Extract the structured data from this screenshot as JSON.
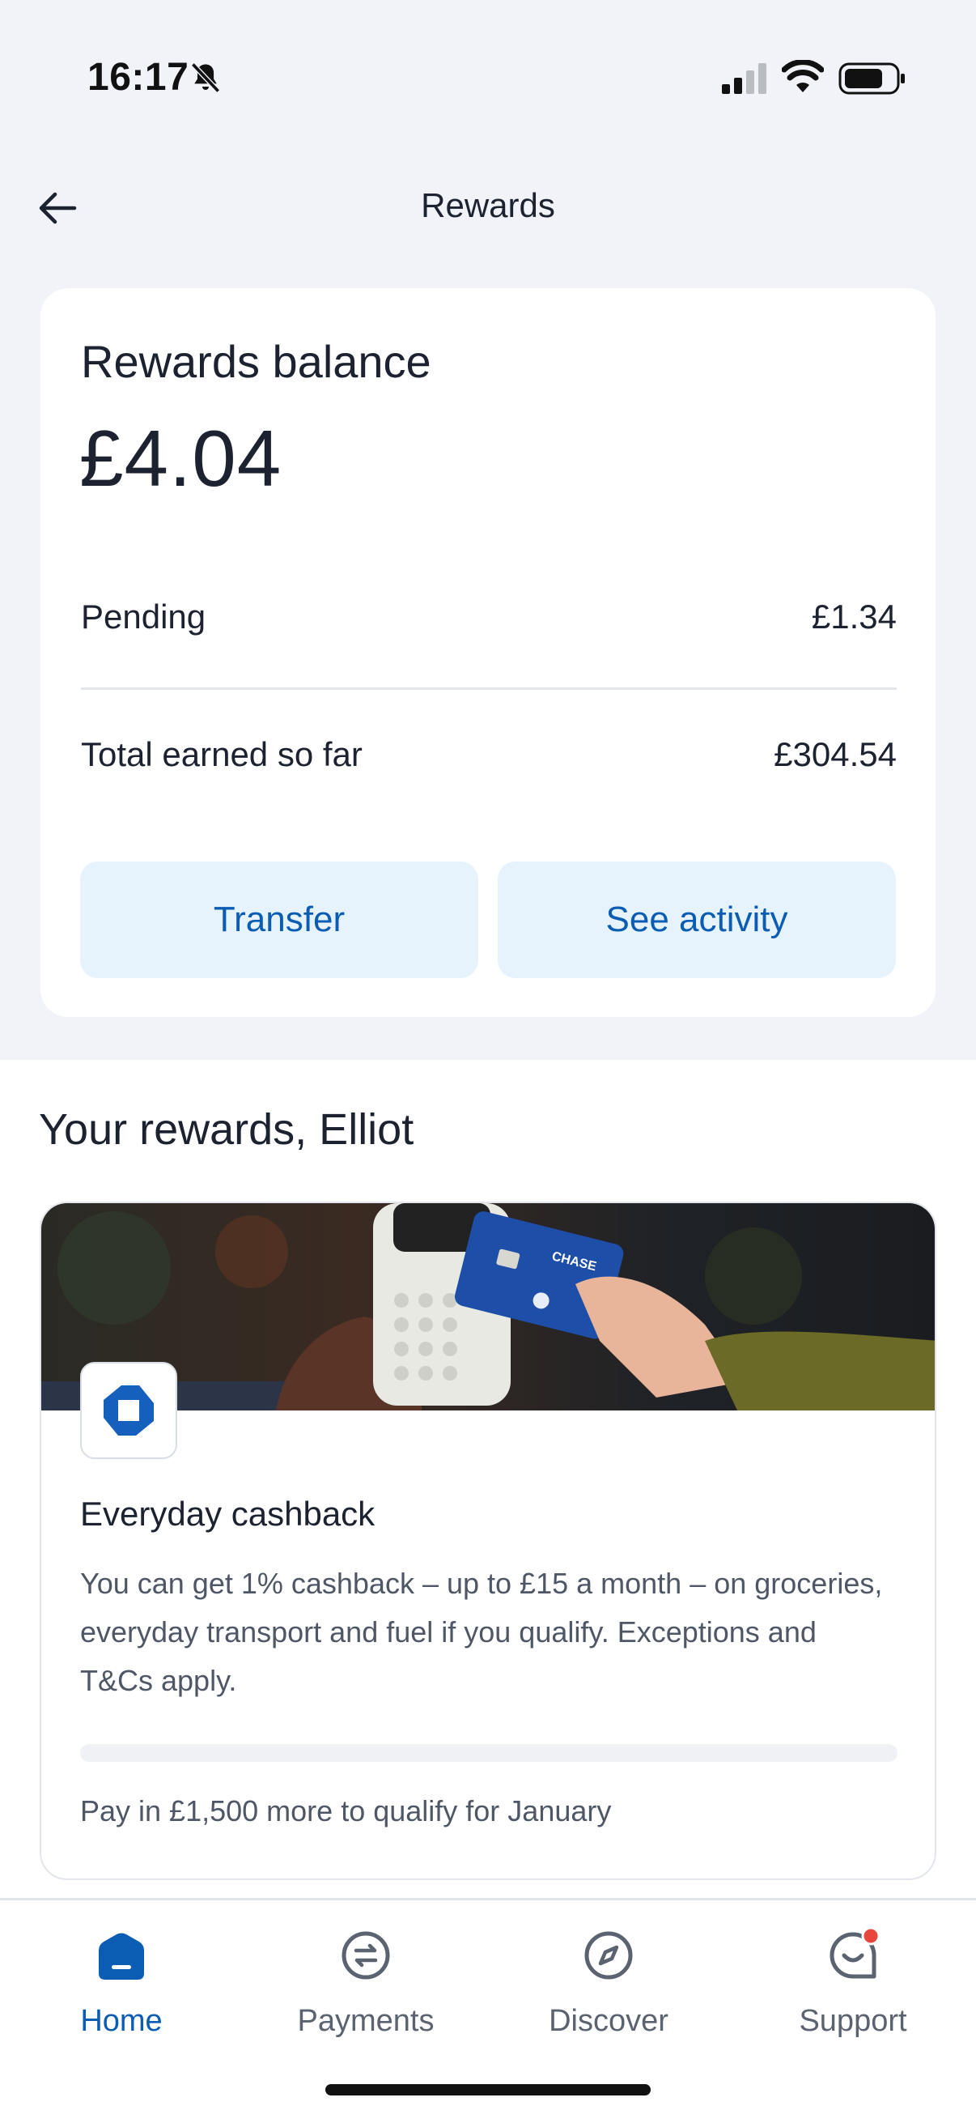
{
  "status_bar": {
    "time": "16:17"
  },
  "header": {
    "title": "Rewards"
  },
  "balance": {
    "heading": "Rewards balance",
    "amount": "£4.04",
    "pending_label": "Pending",
    "pending_value": "£1.34",
    "total_label": "Total earned so far",
    "total_value": "£304.54",
    "transfer_label": "Transfer",
    "activity_label": "See activity"
  },
  "rewards": {
    "heading": "Your rewards, Elliot",
    "card": {
      "title": "Everyday cashback",
      "description": "You can get 1% cashback – up to £15 a month – on groceries, everyday transport and fuel if you qualify. Exceptions and T&Cs apply.",
      "progress_fraction": 0.0,
      "progress_text": "Pay in £1,500 more to qualify for January",
      "card_brand_text": "CHASE"
    }
  },
  "tabs": [
    {
      "label": "Home",
      "icon": "home-icon",
      "active": true
    },
    {
      "label": "Payments",
      "icon": "payments-icon",
      "active": false
    },
    {
      "label": "Discover",
      "icon": "compass-icon",
      "active": false
    },
    {
      "label": "Support",
      "icon": "support-chat-icon",
      "active": false
    }
  ],
  "colors": {
    "accent": "#0b5db3",
    "button_bg": "#e6f3fd",
    "page_bg": "#f1f3f8",
    "notification_dot": "#e8453c"
  }
}
